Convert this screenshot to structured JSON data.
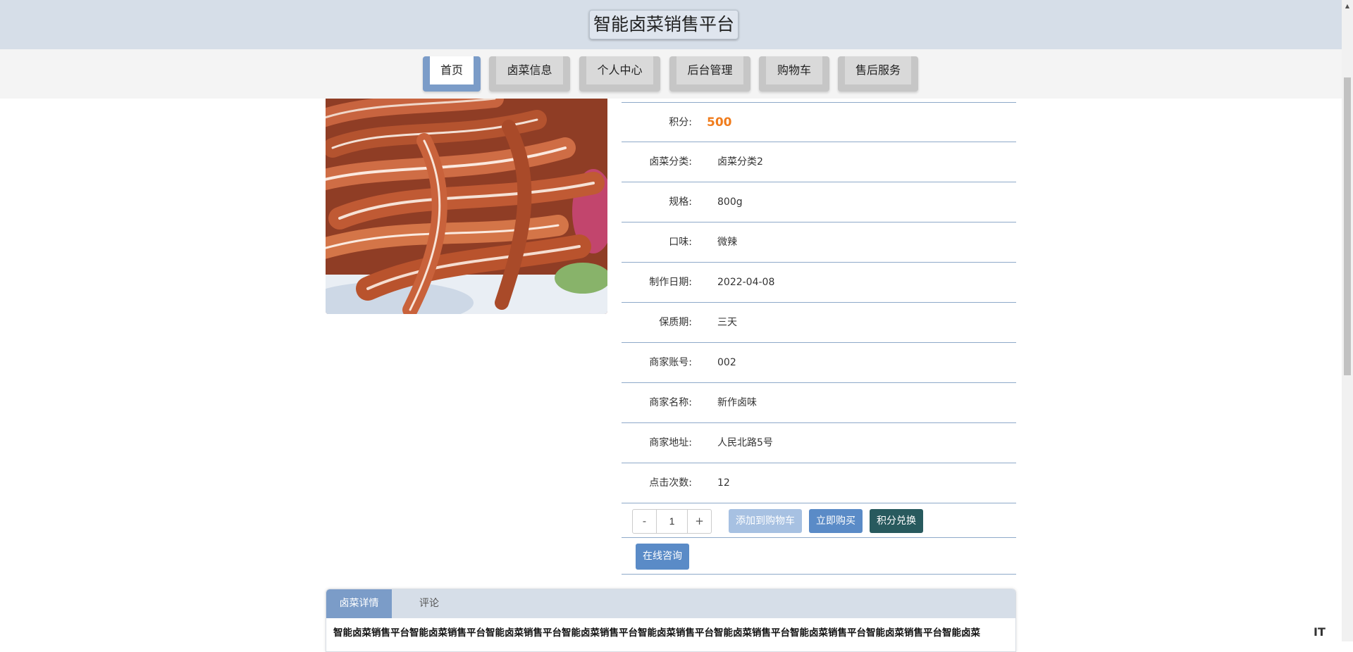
{
  "header": {
    "title": "智能卤菜销售平台"
  },
  "nav": {
    "items": [
      {
        "label": "首页",
        "active": true
      },
      {
        "label": "卤菜信息"
      },
      {
        "label": "个人中心"
      },
      {
        "label": "后台管理"
      },
      {
        "label": "购物车"
      },
      {
        "label": "售后服务"
      }
    ]
  },
  "product": {
    "fields": [
      {
        "label": "积分:",
        "value": "500"
      },
      {
        "label": "卤菜分类:",
        "value": "卤菜分类2"
      },
      {
        "label": "规格:",
        "value": "800g"
      },
      {
        "label": "口味:",
        "value": "微辣"
      },
      {
        "label": "制作日期:",
        "value": "2022-04-08"
      },
      {
        "label": "保质期:",
        "value": "三天"
      },
      {
        "label": "商家账号:",
        "value": "002"
      },
      {
        "label": "商家名称:",
        "value": "新作卤味"
      },
      {
        "label": "商家地址:",
        "value": "人民北路5号"
      },
      {
        "label": "点击次数:",
        "value": "12"
      }
    ],
    "quantity": {
      "minus": "-",
      "value": "1",
      "plus": "+"
    },
    "actions": {
      "add_to_cart": "添加到购物车",
      "buy_now": "立即购买",
      "points_exchange": "积分兑换",
      "online_consult": "在线咨询"
    }
  },
  "detail": {
    "tabs": [
      "卤菜详情",
      "评论"
    ],
    "text": "智能卤菜销售平台智能卤菜销售平台智能卤菜销售平台智能卤菜销售平台智能卤菜销售平台智能卤菜销售平台智能卤菜销售平台智能卤菜销售平台智能卤菜"
  },
  "watermark": "IT"
}
